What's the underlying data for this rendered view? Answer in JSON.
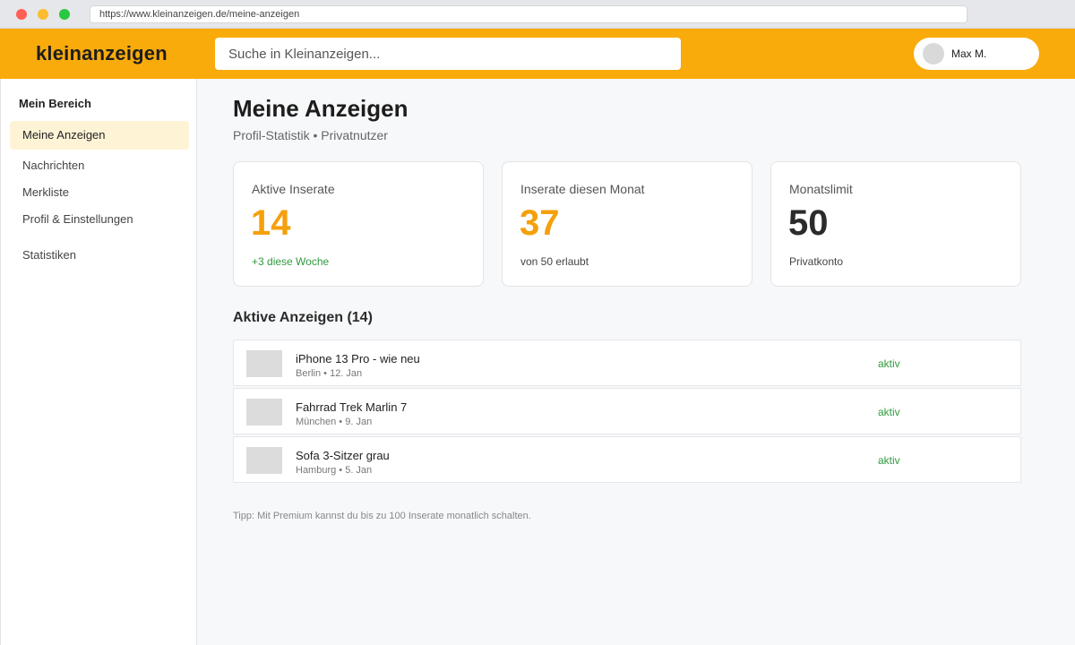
{
  "browser": {
    "url": "https://www.kleinanzeigen.de/meine-anzeigen"
  },
  "header": {
    "logo": "kleinanzeigen",
    "search_placeholder": "Suche in Kleinanzeigen...",
    "user_name": "Max M.",
    "brand_color": "#f9ab0c"
  },
  "sidebar": {
    "title": "Mein Bereich",
    "items": [
      {
        "label": "Meine Anzeigen",
        "active": true
      },
      {
        "label": "Nachrichten"
      },
      {
        "label": "Merkliste"
      },
      {
        "label": "Profil & Einstellungen"
      },
      {
        "label": "Statistiken"
      }
    ]
  },
  "main": {
    "title": "Meine Anzeigen",
    "subtitle": "Profil-Statistik • Privatnutzer",
    "cards": [
      {
        "label": "Aktive Inserate",
        "value": "14",
        "note": "+3 diese Woche"
      },
      {
        "label": "Inserate diesen Monat",
        "value": "37",
        "note": "von 50 erlaubt"
      },
      {
        "label": "Monatslimit",
        "value": "50",
        "note": "Privatkonto"
      }
    ],
    "section_title": "Aktive Anzeigen (14)",
    "listings": [
      {
        "title": "iPhone 13 Pro - wie neu",
        "meta": "Berlin • 12. Jan",
        "status": "aktiv"
      },
      {
        "title": "Fahrrad Trek Marlin 7",
        "meta": "München • 9. Jan",
        "status": "aktiv"
      },
      {
        "title": "Sofa 3-Sitzer grau",
        "meta": "Hamburg • 5. Jan",
        "status": "aktiv"
      }
    ],
    "tip": "Tipp: Mit Premium kannst du bis zu 100 Inserate monatlich schalten."
  }
}
